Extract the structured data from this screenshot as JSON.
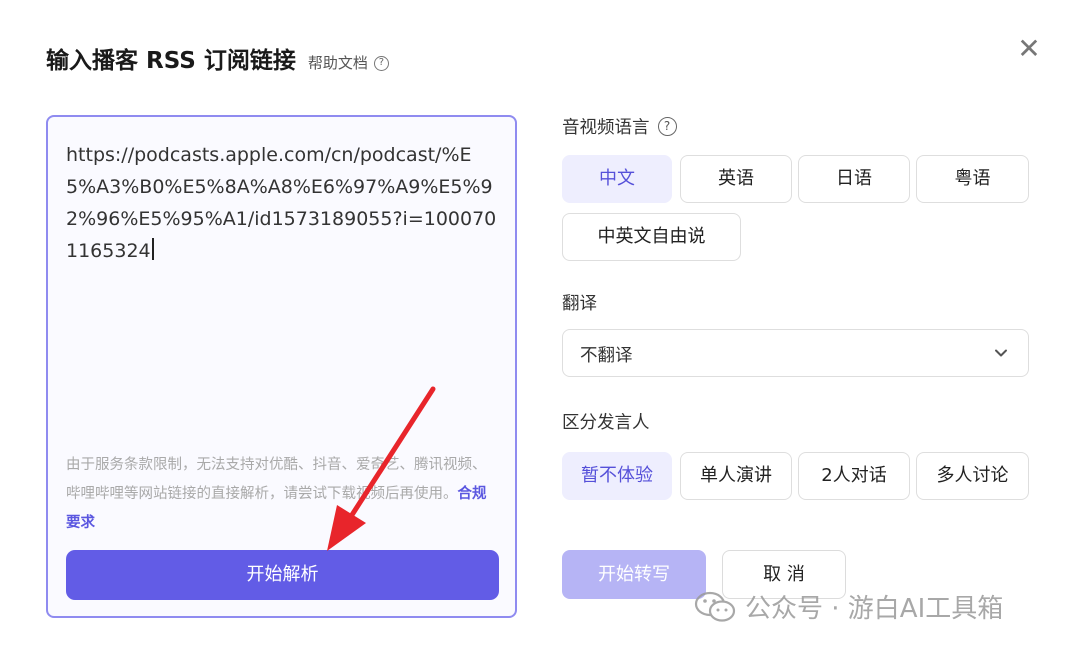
{
  "header": {
    "title": "输入播客 RSS 订阅链接",
    "help_label": "帮助文档",
    "help_icon": "question-circle-icon"
  },
  "close_icon": "close-icon",
  "input": {
    "url": "https://podcasts.apple.com/cn/podcast/%E5%A3%B0%E5%8A%A8%E6%97%A9%E5%92%96%E5%95%A1/id1573189055?i=1000701165324",
    "notice": "由于服务条款限制，无法支持对优酷、抖音、爱奇艺、腾讯视频、哔哩哔哩等网站链接的直接解析，请尝试下载视频后再使用。",
    "notice_link": "合规要求",
    "parse_button": "开始解析"
  },
  "language": {
    "label": "音视频语言",
    "options": [
      "中文",
      "英语",
      "日语",
      "粤语",
      "中英文自由说"
    ],
    "selected": "中文"
  },
  "translate": {
    "label": "翻译",
    "value": "不翻译"
  },
  "speaker": {
    "label": "区分发言人",
    "options": [
      "暂不体验",
      "单人演讲",
      "2人对话",
      "多人讨论"
    ],
    "selected": "暂不体验"
  },
  "actions": {
    "start": "开始转写",
    "cancel": "取 消"
  },
  "watermark": {
    "text": "公众号 · 游白AI工具箱",
    "icon": "wechat-icon"
  },
  "colors": {
    "accent": "#625ce6",
    "accent_light": "#eeeefe",
    "disabled": "#b6b4f5",
    "arrow": "#e8252b"
  }
}
